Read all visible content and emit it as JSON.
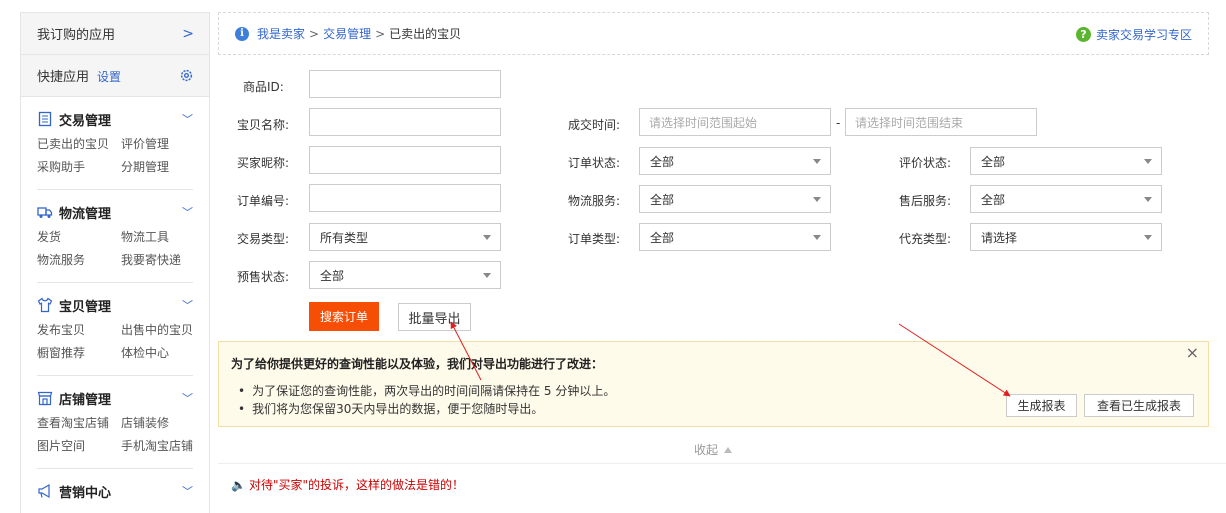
{
  "sidebar": {
    "subscribed": {
      "label": "我订购的应用",
      "arrow": ">"
    },
    "quick": {
      "label": "快捷应用",
      "settings_link": "设置"
    },
    "sections": [
      {
        "title": "交易管理",
        "icon": "clipboard-icon",
        "links": [
          "已卖出的宝贝",
          "评价管理",
          "采购助手",
          "分期管理"
        ]
      },
      {
        "title": "物流管理",
        "icon": "truck-icon",
        "links": [
          "发货",
          "物流工具",
          "物流服务",
          "我要寄快递"
        ]
      },
      {
        "title": "宝贝管理",
        "icon": "tshirt-icon",
        "links": [
          "发布宝贝",
          "出售中的宝贝",
          "橱窗推荐",
          "体检中心"
        ]
      },
      {
        "title": "店铺管理",
        "icon": "shop-icon",
        "links": [
          "查看淘宝店铺",
          "店铺装修",
          "图片空间",
          "手机淘宝店铺"
        ]
      },
      {
        "title": "营销中心",
        "icon": "megaphone-icon",
        "links": []
      }
    ]
  },
  "breadcrumb": {
    "items": [
      "我是卖家",
      "交易管理",
      "已卖出的宝贝"
    ],
    "separator": ">",
    "help_link": "卖家交易学习专区"
  },
  "form": {
    "product_id": {
      "label": "商品ID:",
      "value": ""
    },
    "item_name": {
      "label": "宝贝名称:",
      "value": ""
    },
    "deal_time": {
      "label": "成交时间:",
      "start_placeholder": "请选择时间范围起始",
      "dash": "-",
      "end_placeholder": "请选择时间范围结束"
    },
    "buyer_nick": {
      "label": "买家昵称:",
      "value": ""
    },
    "order_status": {
      "label": "订单状态:",
      "value": "全部"
    },
    "review_status": {
      "label": "评价状态:",
      "value": "全部"
    },
    "order_no": {
      "label": "订单编号:",
      "value": ""
    },
    "logistics_service": {
      "label": "物流服务:",
      "value": "全部"
    },
    "after_sale": {
      "label": "售后服务:",
      "value": "全部"
    },
    "trade_type": {
      "label": "交易类型:",
      "value": "所有类型"
    },
    "order_type": {
      "label": "订单类型:",
      "value": "全部"
    },
    "recharge_type": {
      "label": "代充类型:",
      "value": "请选择"
    },
    "presale_status": {
      "label": "预售状态:",
      "value": "全部"
    },
    "search_button": "搜索订单",
    "export_button": "批量导出"
  },
  "notice": {
    "title": "为了给你提供更好的查询性能以及体验，我们对导出功能进行了改进：",
    "bullets": [
      "为了保证您的查询性能，两次导出的时间间隔请保持在 5 分钟以上。",
      "我们将为您保留30天内导出的数据，便于您随时导出。"
    ],
    "generate_button": "生成报表",
    "view_button": "查看已生成报表",
    "close": "×"
  },
  "collapse_label": "收起",
  "warning_text": "对待\"买家\"的投诉，这样的做法是错的！",
  "colors": {
    "primary_button": "#f64f05",
    "link": "#3366cc",
    "warning": "#cc0000",
    "notice_bg": "#fffbeb",
    "annotation_arrow": "#e02020"
  }
}
